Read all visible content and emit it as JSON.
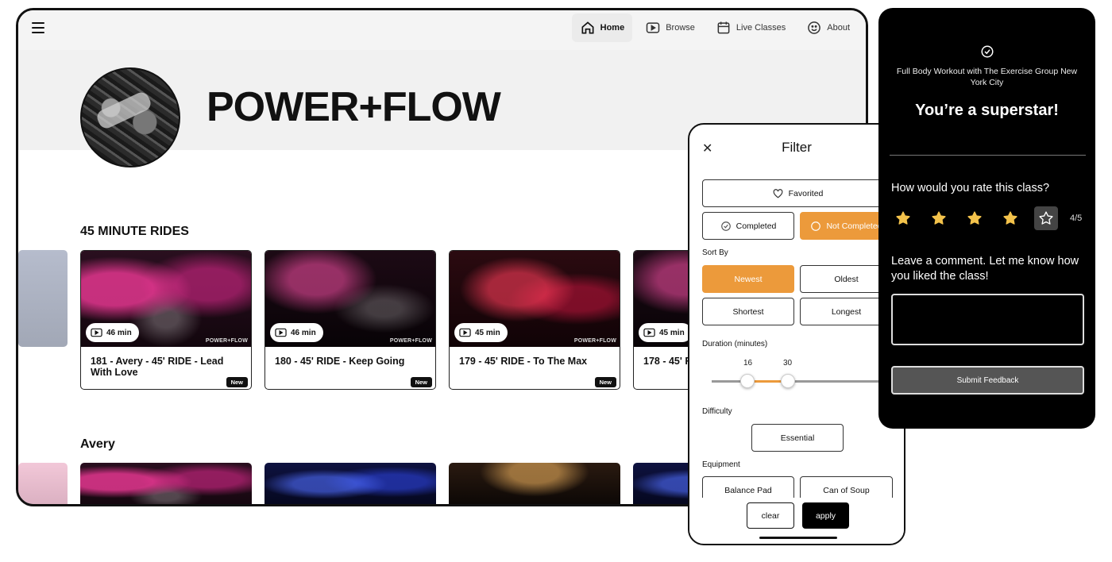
{
  "nav": {
    "items": [
      {
        "label": "Home",
        "icon": "home-icon",
        "active": true
      },
      {
        "label": "Browse",
        "icon": "play-square-icon",
        "active": false
      },
      {
        "label": "Live Classes",
        "icon": "calendar-icon",
        "active": false
      },
      {
        "label": "About",
        "icon": "smiley-icon",
        "active": false
      }
    ]
  },
  "hero": {
    "title": "POWER+FLOW"
  },
  "sections": [
    {
      "title": "45 MINUTE RIDES",
      "cards": [
        {
          "duration": "46 min",
          "title": "181 - Avery - 45' RIDE - Lead With Love",
          "badge": "New",
          "watermark": "POWER+FLOW"
        },
        {
          "duration": "46 min",
          "title": "180 - 45' RIDE - Keep Going",
          "badge": "New",
          "watermark": "POWER+FLOW"
        },
        {
          "duration": "45 min",
          "title": "179 - 45' RIDE - To The Max",
          "badge": "New",
          "watermark": "POWER+FLOW"
        },
        {
          "duration": "45 min",
          "title": "178 - 45' R",
          "badge": "",
          "watermark": ""
        }
      ]
    },
    {
      "title": "Avery"
    }
  ],
  "filter": {
    "title": "Filter",
    "favorited": "Favorited",
    "completed": "Completed",
    "not_completed": "Not Completed",
    "sort_by_label": "Sort By",
    "sort_options": [
      "Newest",
      "Oldest",
      "Shortest",
      "Longest"
    ],
    "sort_selected": "Newest",
    "duration_label": "Duration (minutes)",
    "duration_min": "16",
    "duration_max": "30",
    "difficulty_label": "Difficulty",
    "difficulty_option": "Essential",
    "equipment_label": "Equipment",
    "equipment_options": [
      "Balance Pad",
      "Can of Soup"
    ],
    "clear_label": "clear",
    "apply_label": "apply",
    "accent_color": "#ec9a3b"
  },
  "feedback": {
    "class_name": "Full Body Workout with The Exercise Group New York City",
    "headline": "You’re a superstar!",
    "question": "How would you rate this class?",
    "rating": 4,
    "rating_max": 5,
    "rating_text": "4/5",
    "comment_prompt": "Leave a comment. Let me know how you liked the class!",
    "textarea_value": "",
    "submit_label": "Submit Feedback",
    "star_color": "#f3c24b"
  }
}
